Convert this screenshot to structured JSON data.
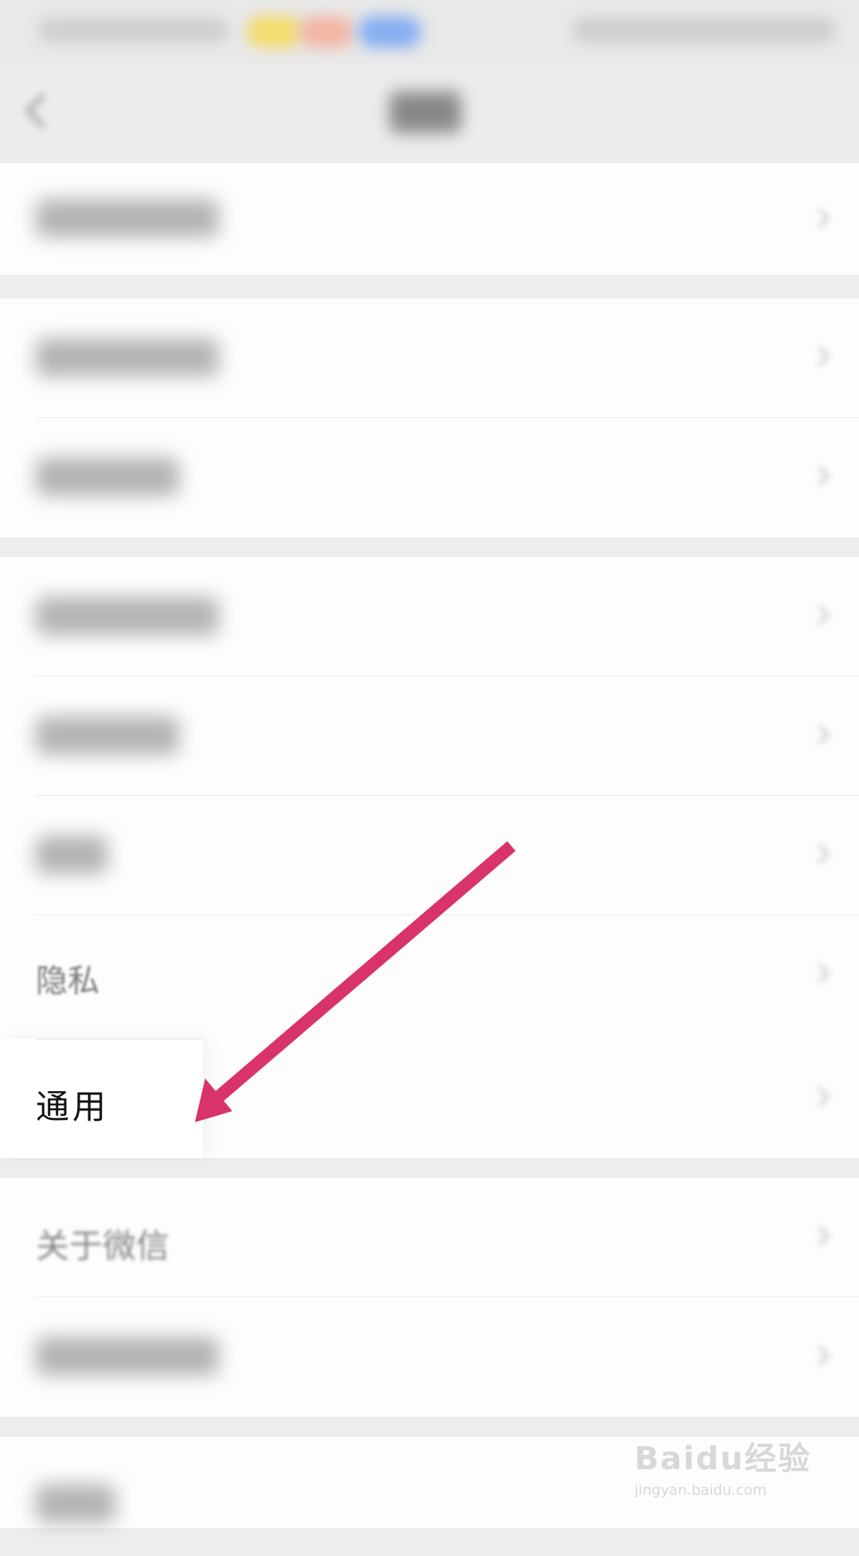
{
  "list": {
    "privacy_label": "隐私",
    "general_label": "通用",
    "about_label": "关于微信"
  },
  "annotation": {
    "arrow_color": "#d9336b"
  },
  "watermark": {
    "brand": "Baidu经验",
    "url": "jingyan.baidu.com"
  },
  "icons": [
    "back-icon",
    "chevron-right-icon",
    "arrow-annotation"
  ]
}
